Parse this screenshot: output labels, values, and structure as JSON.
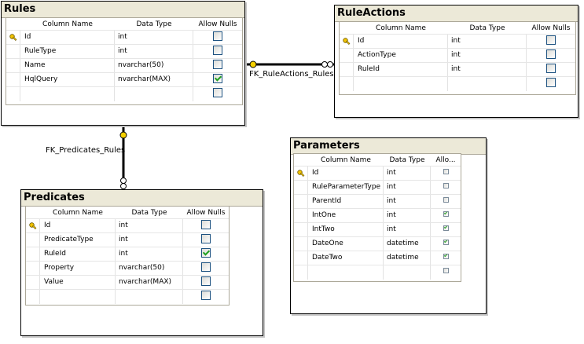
{
  "relationships": [
    {
      "label": "FK_RuleActions_Rules"
    },
    {
      "label": "FK_Predicates_Rules"
    }
  ],
  "tables": {
    "rules": {
      "title": "Rules",
      "headers": [
        "Column Name",
        "Data Type",
        "Allow Nulls"
      ],
      "rows": [
        {
          "name": "Id",
          "type": "int",
          "nulls": false,
          "key": true
        },
        {
          "name": "RuleType",
          "type": "int",
          "nulls": false,
          "key": false
        },
        {
          "name": "Name",
          "type": "nvarchar(50)",
          "nulls": false,
          "key": false
        },
        {
          "name": "HqlQuery",
          "type": "nvarchar(MAX)",
          "nulls": true,
          "key": false
        },
        {
          "name": "",
          "type": "",
          "nulls": false,
          "key": false
        }
      ]
    },
    "ruleActions": {
      "title": "RuleActions",
      "headers": [
        "Column Name",
        "Data Type",
        "Allow Nulls"
      ],
      "rows": [
        {
          "name": "Id",
          "type": "int",
          "nulls": false,
          "key": true
        },
        {
          "name": "ActionType",
          "type": "int",
          "nulls": false,
          "key": false
        },
        {
          "name": "RuleId",
          "type": "int",
          "nulls": false,
          "key": false
        },
        {
          "name": "",
          "type": "",
          "nulls": false,
          "key": false
        }
      ]
    },
    "parameters": {
      "title": "Parameters",
      "headers": [
        "Column Name",
        "Data Type",
        "Allo..."
      ],
      "rows": [
        {
          "name": "Id",
          "type": "int",
          "nulls": false,
          "key": true
        },
        {
          "name": "RuleParameterType",
          "type": "int",
          "nulls": false,
          "key": false
        },
        {
          "name": "ParentId",
          "type": "int",
          "nulls": false,
          "key": false
        },
        {
          "name": "IntOne",
          "type": "int",
          "nulls": true,
          "key": false
        },
        {
          "name": "IntTwo",
          "type": "int",
          "nulls": true,
          "key": false
        },
        {
          "name": "DateOne",
          "type": "datetime",
          "nulls": true,
          "key": false
        },
        {
          "name": "DateTwo",
          "type": "datetime",
          "nulls": true,
          "key": false
        },
        {
          "name": "",
          "type": "",
          "nulls": false,
          "key": false
        }
      ]
    },
    "predicates": {
      "title": "Predicates",
      "headers": [
        "Column Name",
        "Data Type",
        "Allow Nulls"
      ],
      "rows": [
        {
          "name": "Id",
          "type": "int",
          "nulls": false,
          "key": true
        },
        {
          "name": "PredicateType",
          "type": "int",
          "nulls": false,
          "key": false
        },
        {
          "name": "RuleId",
          "type": "int",
          "nulls": true,
          "key": false
        },
        {
          "name": "Property",
          "type": "nvarchar(50)",
          "nulls": false,
          "key": false
        },
        {
          "name": "Value",
          "type": "nvarchar(MAX)",
          "nulls": false,
          "key": false
        },
        {
          "name": "",
          "type": "",
          "nulls": false,
          "key": false
        }
      ]
    }
  }
}
